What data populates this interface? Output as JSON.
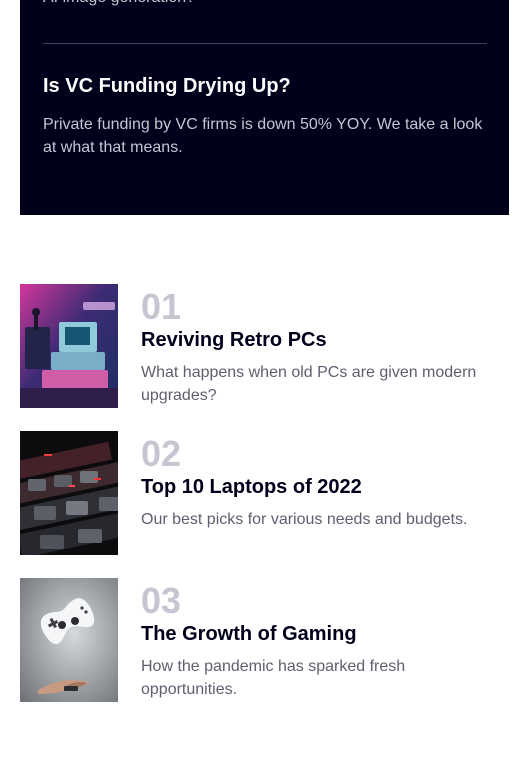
{
  "featured": {
    "cut_text": "AI image generation?",
    "title": "Is VC Funding Drying Up?",
    "description": "Private funding by VC firms is down 50% YOY. We take a look at what that means."
  },
  "articles": [
    {
      "number": "01",
      "title": "Reviving Retro PCs",
      "excerpt": "What happens when old PCs are given modern upgrades?",
      "image": "retro-pc-image"
    },
    {
      "number": "02",
      "title": "Top 10 Laptops of 2022",
      "excerpt": "Our best picks for various needs and budgets.",
      "image": "laptop-keyboard-image"
    },
    {
      "number": "03",
      "title": "The Growth of Gaming",
      "excerpt": "How the pandemic has sparked fresh opportunities.",
      "image": "game-controller-image"
    }
  ],
  "colors": {
    "dark_background": "#00001a",
    "heading": "#00001a",
    "muted_number": "#c5c6d1",
    "body_text": "#5d5f6f"
  }
}
